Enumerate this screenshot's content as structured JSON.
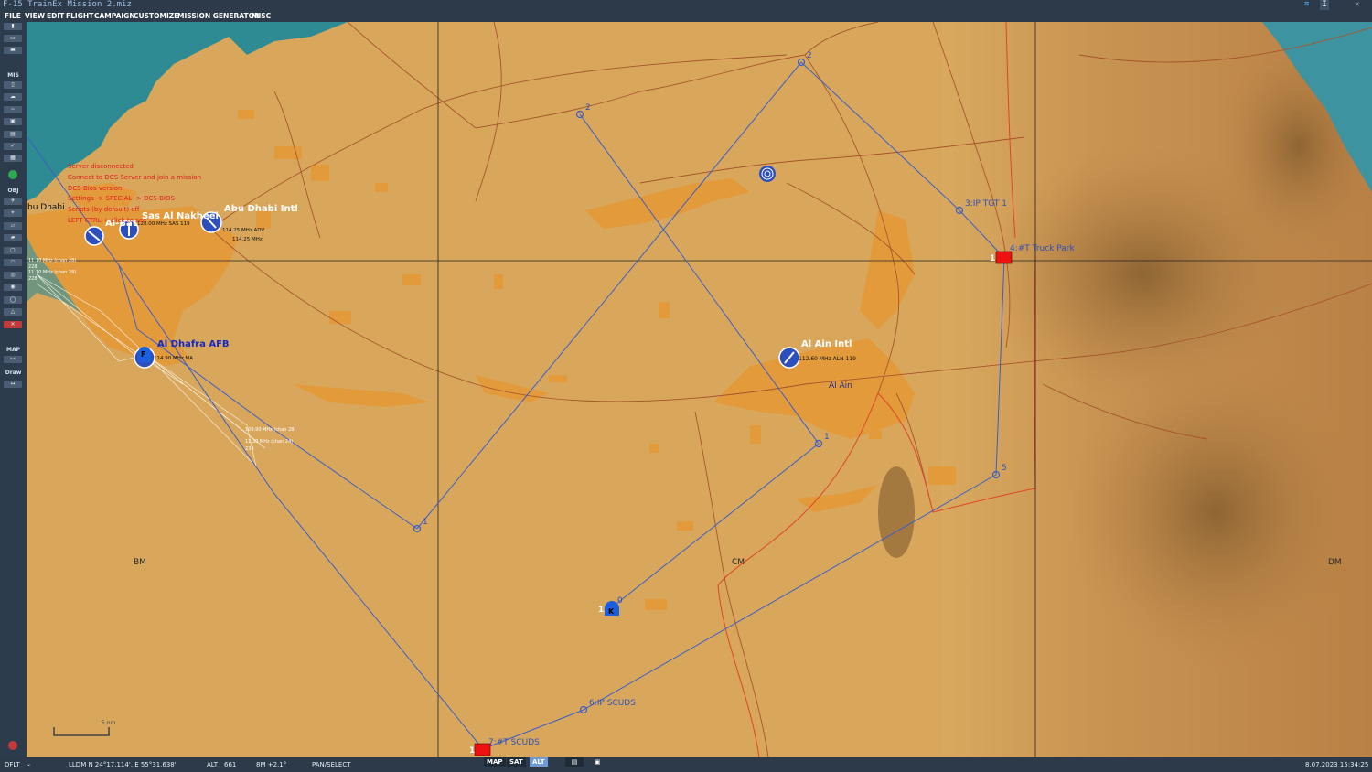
{
  "window": {
    "title": "F-15 TrainEx Mission 2.miz"
  },
  "menu": [
    "FILE",
    "VIEW",
    "EDIT",
    "FLIGHT",
    "CAMPAIGN",
    "CUSTOMIZE",
    "MISSION GENERATOR",
    "MISC"
  ],
  "sidebar": {
    "sections": [
      "MIS",
      "OBJ",
      "MAP",
      "Draw"
    ]
  },
  "airbases": [
    {
      "name": "Abu Dhabi Intl",
      "freq": "114.25 MHz ADV",
      "freq2": "114.25 MHz"
    },
    {
      "name": "Al Ain Intl",
      "freq": "112.60 MHz ALN 119"
    },
    {
      "name": "Al Dhafra AFB",
      "freq": "114.90 MHz MA"
    },
    {
      "name": "Sas Al Nakheel",
      "freq": "128.00 MHz SAS 119"
    },
    {
      "name": "Al-Bat"
    }
  ],
  "towns": {
    "abu_dhabi": "bu Dhabi",
    "al_ain": "Al Ain"
  },
  "waypoints": {
    "wp2a": "2",
    "wp2b": "2",
    "wp3": "3:IP TGT 1",
    "wp4": "4:#T Truck  Park",
    "wp1a": "1",
    "wp1b": "1",
    "wp5": "5",
    "wp0": "0",
    "wp6": "6:IP SCUDS",
    "wp7": "7:#T SCUDS"
  },
  "group_labels": {
    "k_marker": "K",
    "k_num": "1",
    "f_marker": "F",
    "truck_num": "1",
    "scud_num": "1"
  },
  "grid_labels": [
    "BM",
    "CM",
    "DM"
  ],
  "overlay_messages": [
    "Server disconnected",
    "Connect to DCS Server and join a mission",
    "DCS Bios version:",
    "Settings -> SPECIAL -> DCS-BIOS",
    "Scripts (by default) off",
    "LEFT CTRL + click to see"
  ],
  "dhafra_tacan": [
    "11.10 MHz (chan 28)",
    "228",
    "11.10 MHz (chan 28)",
    "228"
  ],
  "route_freqs": [
    "109.90 MHz (chan 28)",
    "11.30 MHz (chan 24)",
    "234"
  ],
  "scale": {
    "label": "5 nm"
  },
  "status": {
    "profile": "DFLT",
    "coords": "LLDM  N 24°17.114', E 55°31.638'",
    "alt_label": "ALT",
    "alt_value": "661",
    "bearing": "8M  +2.1°",
    "mode": "PAN/SELECT",
    "map_btn": "MAP",
    "sat_btn": "SAT",
    "alt_btn": "ALT",
    "datetime": "8.07.2023 15:34:25"
  },
  "colors": {
    "desert": "#d7a55a",
    "water": "#2e8a93",
    "urban": "#e39a3b",
    "route": "#3a5ec8",
    "chrome": "#2c3a4a",
    "target": "#ee1111"
  }
}
